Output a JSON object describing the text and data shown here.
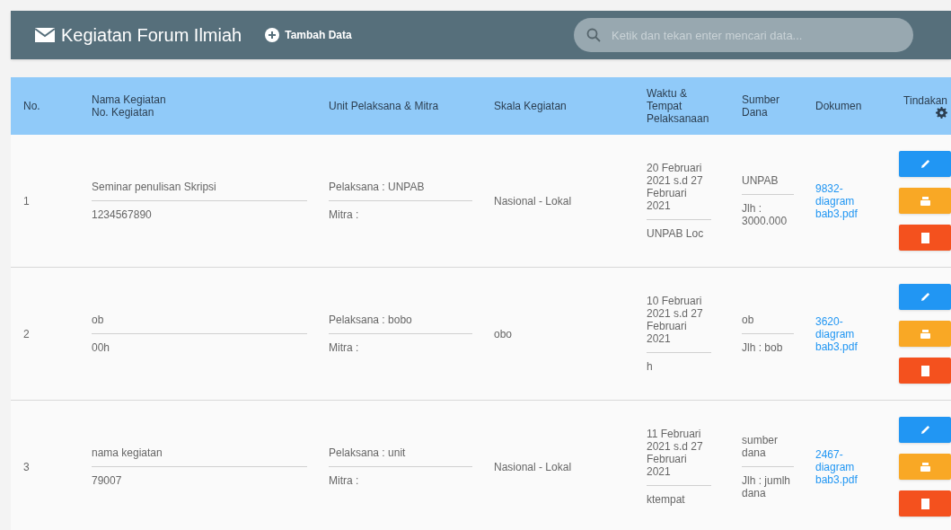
{
  "header": {
    "title": "Kegiatan Forum Ilmiah",
    "add_button": "Tambah Data",
    "search": {
      "placeholder": "Ketik dan tekan enter mencari data..."
    }
  },
  "table": {
    "columns": [
      "No.",
      "Nama Kegiatan\nNo. Kegiatan",
      "Unit Pelaksana & Mitra",
      "Skala Kegiatan",
      "Waktu &\nTempat\nPelaksanaan",
      "Sumber\nDana",
      "Dokumen",
      "Tindakan"
    ],
    "rows": [
      {
        "no": "1",
        "name": "Seminar penulisan Skripsi",
        "number": "1234567890",
        "pelaksana": "Pelaksana : UNPAB",
        "mitra": "Mitra :",
        "skala": "Nasional - Lokal",
        "waktu": "20 Februari 2021 s.d 27 Februari 2021",
        "tempat": "UNPAB Loc",
        "sumber": "UNPAB",
        "jumlah": "Jlh : 3000.000",
        "dokumen": "9832-diagram bab3.pdf"
      },
      {
        "no": "2",
        "name": "ob",
        "number": "00h",
        "pelaksana": "Pelaksana : bobo",
        "mitra": "Mitra :",
        "skala": "obo",
        "waktu": "10 Februari 2021 s.d 27 Februari 2021",
        "tempat": "h",
        "sumber": "ob",
        "jumlah": "Jlh : bob",
        "dokumen": "3620-diagram bab3.pdf"
      },
      {
        "no": "3",
        "name": "nama kegiatan",
        "number": "79007",
        "pelaksana": "Pelaksana : unit",
        "mitra": "Mitra :",
        "skala": "Nasional - Lokal",
        "waktu": "11 Februari 2021 s.d 27 Februari 2021",
        "tempat": "ktempat",
        "sumber": "sumber dana",
        "jumlah": "Jlh : jumlh dana",
        "dokumen": "2467-diagram bab3.pdf"
      }
    ]
  }
}
